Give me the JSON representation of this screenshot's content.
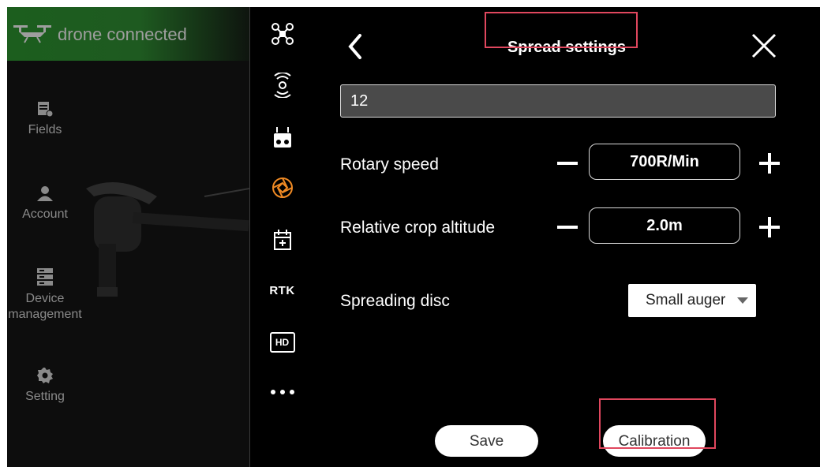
{
  "status": {
    "text": "drone connected"
  },
  "sidebar": {
    "items": [
      {
        "label": "Fields",
        "icon": "fields-icon"
      },
      {
        "label": "Account",
        "icon": "account-icon"
      },
      {
        "label": "Device management",
        "icon": "device-icon"
      },
      {
        "label": "Setting",
        "icon": "gear-icon"
      }
    ]
  },
  "icon_column": {
    "items": [
      {
        "icon": "drone-icon"
      },
      {
        "icon": "signal-icon"
      },
      {
        "icon": "remote-controller-icon"
      },
      {
        "icon": "spreader-icon",
        "active": true
      },
      {
        "icon": "calendar-icon"
      },
      {
        "label": "RTK",
        "icon": "rtk-icon"
      },
      {
        "label": "HD",
        "icon": "hd-icon"
      },
      {
        "icon": "more-icon"
      }
    ],
    "active_color": "#f08a24"
  },
  "panel": {
    "title": "Spread settings",
    "input_value": "12",
    "rotary_speed": {
      "label": "Rotary speed",
      "value": "700R/Min"
    },
    "crop_altitude": {
      "label": "Relative crop altitude",
      "value": "2.0m"
    },
    "spreading_disc": {
      "label": "Spreading disc",
      "value": "Small auger"
    },
    "save_label": "Save",
    "calibration_label": "Calibration"
  },
  "colors": {
    "highlight": "#e0475e",
    "status_green": "#1e5a20"
  }
}
